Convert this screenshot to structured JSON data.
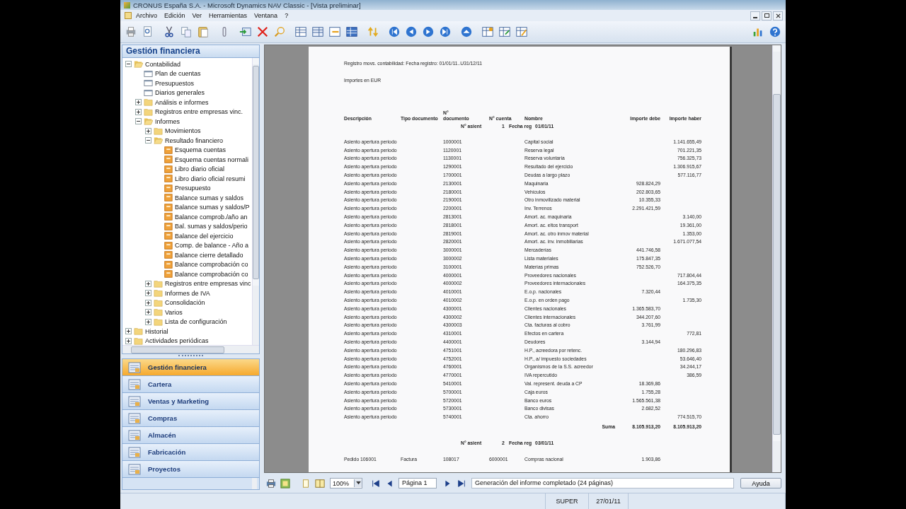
{
  "window": {
    "title": "CRONUS España S.A. - Microsoft Dynamics NAV Classic - [Vista preliminar]"
  },
  "menu": [
    "Archivo",
    "Edición",
    "Ver",
    "Herramientas",
    "Ventana",
    "?"
  ],
  "sidebar": {
    "title": "Gestión financiera",
    "tree": [
      {
        "label": "Contabilidad",
        "kind": "folder",
        "expanded": true,
        "children": [
          {
            "label": "Plan de cuentas",
            "kind": "form"
          },
          {
            "label": "Presupuestos",
            "kind": "form"
          },
          {
            "label": "Diarios generales",
            "kind": "form"
          },
          {
            "label": "Análisis e informes",
            "kind": "folder",
            "expanded": false
          },
          {
            "label": "Registros entre empresas vinc.",
            "kind": "folder",
            "expanded": false
          },
          {
            "label": "Informes",
            "kind": "folder",
            "expanded": true,
            "children": [
              {
                "label": "Movimientos",
                "kind": "folder",
                "expanded": false
              },
              {
                "label": "Resultado financiero",
                "kind": "folder",
                "expanded": true,
                "children": [
                  {
                    "label": "Esquema cuentas",
                    "kind": "report"
                  },
                  {
                    "label": "Esquema cuentas normali",
                    "kind": "report"
                  },
                  {
                    "label": "Libro diario oficial",
                    "kind": "report"
                  },
                  {
                    "label": "Libro diario oficial resumi",
                    "kind": "report"
                  },
                  {
                    "label": "Presupuesto",
                    "kind": "report"
                  },
                  {
                    "label": "Balance sumas y saldos",
                    "kind": "report"
                  },
                  {
                    "label": "Balance sumas y saldos/P",
                    "kind": "report"
                  },
                  {
                    "label": "Balance comprob./año an",
                    "kind": "report"
                  },
                  {
                    "label": "Bal. sumas y saldos/perio",
                    "kind": "report"
                  },
                  {
                    "label": "Balance del ejercicio",
                    "kind": "report"
                  },
                  {
                    "label": "Comp. de balance - Año a",
                    "kind": "report"
                  },
                  {
                    "label": "Balance cierre detallado",
                    "kind": "report"
                  },
                  {
                    "label": "Balance comprobación co",
                    "kind": "report"
                  },
                  {
                    "label": "Balance comprobación co",
                    "kind": "report"
                  }
                ]
              },
              {
                "label": "Registros entre empresas vinc",
                "kind": "folder",
                "expanded": false
              },
              {
                "label": "Informes de IVA",
                "kind": "folder",
                "expanded": false
              },
              {
                "label": "Consolidación",
                "kind": "folder",
                "expanded": false
              },
              {
                "label": "Varios",
                "kind": "folder",
                "expanded": false
              },
              {
                "label": "Lista de configuración",
                "kind": "folder",
                "expanded": false
              }
            ]
          }
        ]
      },
      {
        "label": "Historial",
        "kind": "folder",
        "expanded": false
      },
      {
        "label": "Actividades periódicas",
        "kind": "folder",
        "expanded": false
      }
    ],
    "navigation": [
      {
        "label": "Gestión financiera",
        "selected": true
      },
      {
        "label": "Cartera",
        "selected": false
      },
      {
        "label": "Ventas y Marketing",
        "selected": false
      },
      {
        "label": "Compras",
        "selected": false
      },
      {
        "label": "Almacén",
        "selected": false
      },
      {
        "label": "Fabricación",
        "selected": false
      },
      {
        "label": "Proyectos",
        "selected": false
      }
    ]
  },
  "report": {
    "filter_line": "Registro movs. contabilidad: Fecha registro: 01/01/11..U31/12/11",
    "currency_line": "Importes en  EUR",
    "columns": [
      "Descripción",
      "Tipo documento",
      "N° documento",
      "N° cuenta",
      "Nombre",
      "Importe debe",
      "Importe haber"
    ],
    "groups": [
      {
        "entry_label": "N° asient",
        "entry_no": "1",
        "date_label": "Fecha reg",
        "date": "01/01/11",
        "rows": [
          {
            "description": "Asiento apertura periodo",
            "doc_no": "1000001",
            "name": "Capital social",
            "credit": "1.141.655,49"
          },
          {
            "description": "Asiento apertura periodo",
            "doc_no": "1120001",
            "name": "Reserva legal",
            "credit": "701.221,35"
          },
          {
            "description": "Asiento apertura periodo",
            "doc_no": "1130001",
            "name": "Reserva voluntaria",
            "credit": "756.325,73"
          },
          {
            "description": "Asiento apertura periodo",
            "doc_no": "1290001",
            "name": "Resultado del ejercicio",
            "credit": "1.306.915,67"
          },
          {
            "description": "Asiento apertura periodo",
            "doc_no": "1700001",
            "name": "Deudas a largo plazo",
            "credit": "577.116,77"
          },
          {
            "description": "Asiento apertura periodo",
            "doc_no": "2130001",
            "name": "Maquinaria",
            "debit": "928.824,29"
          },
          {
            "description": "Asiento apertura periodo",
            "doc_no": "2180001",
            "name": "Vehículos",
            "debit": "202.803,65"
          },
          {
            "description": "Asiento apertura periodo",
            "doc_no": "2190001",
            "name": "Otro inmovilizado material",
            "debit": "10.355,33"
          },
          {
            "description": "Asiento apertura periodo",
            "doc_no": "2200001",
            "name": "Inv. Terrenos",
            "debit": "2.291.421,59"
          },
          {
            "description": "Asiento apertura periodo",
            "doc_no": "2813001",
            "name": "Amort. ac. maquinaria",
            "credit": "3.140,00"
          },
          {
            "description": "Asiento apertura periodo",
            "doc_no": "2818001",
            "name": "Amort. ac. eltos transport",
            "credit": "19.361,00"
          },
          {
            "description": "Asiento apertura periodo",
            "doc_no": "2819001",
            "name": "Amort. ac. otro inmov material",
            "credit": "1.353,00"
          },
          {
            "description": "Asiento apertura periodo",
            "doc_no": "2820001",
            "name": "Amort. ac. inv. inmobiliarias",
            "credit": "1.671.077,54"
          },
          {
            "description": "Asiento apertura periodo",
            "doc_no": "3000001",
            "name": "Mercaderías",
            "debit": "441.746,58"
          },
          {
            "description": "Asiento apertura periodo",
            "doc_no": "3000002",
            "name": "Lista materiales",
            "debit": "175.847,35"
          },
          {
            "description": "Asiento apertura periodo",
            "doc_no": "3100001",
            "name": "Materias primas",
            "debit": "752.526,70"
          },
          {
            "description": "Asiento apertura periodo",
            "doc_no": "4000001",
            "name": "Proveedores nacionales",
            "credit": "717.804,44"
          },
          {
            "description": "Asiento apertura periodo",
            "doc_no": "4000002",
            "name": "Proveedores internacionales",
            "credit": "164.375,35"
          },
          {
            "description": "Asiento apertura periodo",
            "doc_no": "4010001",
            "name": "E.o.p. nacionales",
            "debit": "7.320,44"
          },
          {
            "description": "Asiento apertura periodo",
            "doc_no": "4010002",
            "name": "E.o.p. en orden pago",
            "credit": "1.735,30"
          },
          {
            "description": "Asiento apertura periodo",
            "doc_no": "4300001",
            "name": "Clientes nacionales",
            "debit": "1.365.583,70"
          },
          {
            "description": "Asiento apertura periodo",
            "doc_no": "4300002",
            "name": "Clientes internacionales",
            "debit": "344.207,60"
          },
          {
            "description": "Asiento apertura periodo",
            "doc_no": "4300003",
            "name": "Cta. facturas al cobro",
            "debit": "3.761,99"
          },
          {
            "description": "Asiento apertura periodo",
            "doc_no": "4310001",
            "name": "Efectos en cartera",
            "credit": "772,81"
          },
          {
            "description": "Asiento apertura periodo",
            "doc_no": "4400001",
            "name": "Deudores",
            "debit": "3.144,94"
          },
          {
            "description": "Asiento apertura periodo",
            "doc_no": "4751001",
            "name": "H.P., acreedora por retenc.",
            "credit": "180.296,83"
          },
          {
            "description": "Asiento apertura periodo",
            "doc_no": "4752001",
            "name": "H.P., a/ impuesto sociedades",
            "credit": "53.646,40"
          },
          {
            "description": "Asiento apertura periodo",
            "doc_no": "4760001",
            "name": "Organismos de la S.S. acreedor",
            "credit": "34.244,17"
          },
          {
            "description": "Asiento apertura periodo",
            "doc_no": "4770001",
            "name": "IVA repercutido",
            "credit": "386,59"
          },
          {
            "description": "Asiento apertura periodo",
            "doc_no": "5410001",
            "name": "Val. represent. deuda a CP",
            "debit": "18.369,86"
          },
          {
            "description": "Asiento apertura periodo",
            "doc_no": "5700001",
            "name": "Caja euros",
            "debit": "1.755,28"
          },
          {
            "description": "Asiento apertura periodo",
            "doc_no": "5720001",
            "name": "Banco euros",
            "debit": "1.565.561,38"
          },
          {
            "description": "Asiento apertura periodo",
            "doc_no": "5730001",
            "name": "Banco divisas",
            "debit": "2.682,52"
          },
          {
            "description": "Asiento apertura periodo",
            "doc_no": "5740001",
            "name": "Cta. ahorro",
            "credit": "774.515,70"
          }
        ],
        "total_label": "Suma",
        "total_debit": "8.105.913,20",
        "total_credit": "8.105.913,20"
      },
      {
        "entry_label": "N° asient",
        "entry_no": "2",
        "date_label": "Fecha reg",
        "date": "03/01/11",
        "rows": [
          {
            "description": "Pedido 106001",
            "doc_type": "Factura",
            "doc_no": "108017",
            "account": "6000001",
            "name": "Compras nacional",
            "debit": "1.903,86"
          }
        ]
      }
    ]
  },
  "preview_toolbar": {
    "zoom": "100%",
    "page": "Página 1",
    "message": "Generación del informe completado (24 páginas)",
    "help_button": "Ayuda"
  },
  "status_bar": {
    "user": "SUPER",
    "date": "27/01/11"
  }
}
